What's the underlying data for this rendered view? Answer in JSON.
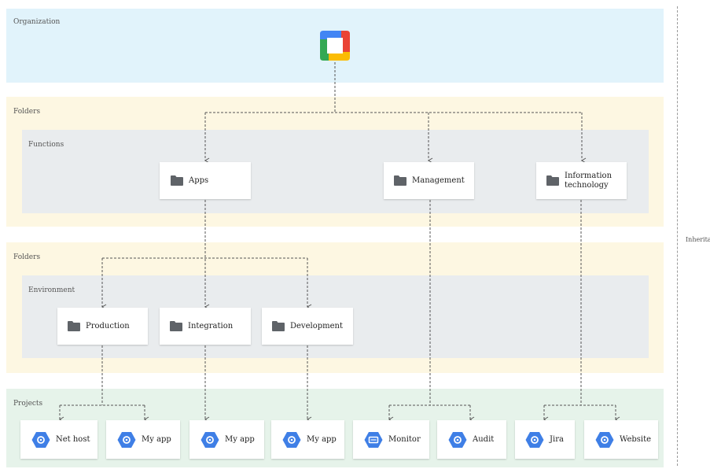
{
  "bands": {
    "organization": "Organization",
    "folders_top": "Folders",
    "functions": "Functions",
    "folders_bottom": "Folders",
    "environment": "Environment",
    "projects": "Projects"
  },
  "side_label": "Inheritance",
  "colors": {
    "organization_band": "#e1f3fb",
    "folders_band": "#fdf7e2",
    "inner_band": "#e9ecee",
    "projects_band": "#e6f3ea",
    "hex_icon": "#3f7fe6",
    "folder_icon": "#5f6368"
  },
  "functions": [
    {
      "label": "Apps",
      "icon": "folder-icon"
    },
    {
      "label": "Management",
      "icon": "folder-icon"
    },
    {
      "label": "Information technology",
      "icon": "folder-icon"
    }
  ],
  "environments": [
    {
      "label": "Production",
      "icon": "folder-icon"
    },
    {
      "label": "Integration",
      "icon": "folder-icon"
    },
    {
      "label": "Development",
      "icon": "folder-icon"
    }
  ],
  "projects": [
    {
      "label": "Net host",
      "icon": "project-hex-icon"
    },
    {
      "label": "My app",
      "icon": "project-hex-icon"
    },
    {
      "label": "My app",
      "icon": "project-hex-icon"
    },
    {
      "label": "My app",
      "icon": "project-hex-icon"
    },
    {
      "label": "Monitor",
      "icon": "monitor-hex-icon"
    },
    {
      "label": "Audit",
      "icon": "project-hex-icon"
    },
    {
      "label": "Jira",
      "icon": "project-hex-icon"
    },
    {
      "label": "Website",
      "icon": "project-hex-icon"
    }
  ]
}
